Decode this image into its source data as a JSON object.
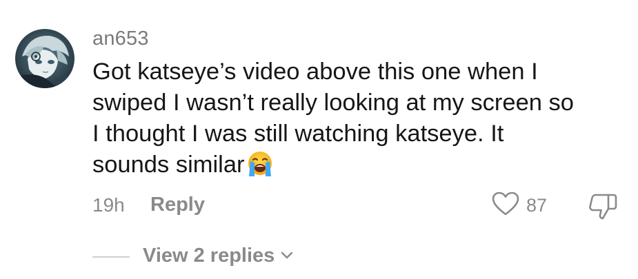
{
  "comment": {
    "username": "an653",
    "text_lines": [
      "Got katseye’s video above this one when I",
      "swiped I wasn’t really looking at my screen so",
      "I thought I was still watching katseye. It",
      "sounds similar"
    ],
    "emoji_icon": "loudly-crying-face-icon",
    "timestamp": "19h",
    "reply_label": "Reply",
    "like_count": "87",
    "view_replies_label": "View 2 replies"
  },
  "colors": {
    "text": "#161616",
    "meta": "#8a8a8a",
    "username": "#7a7a7a",
    "divider": "#cfcfcf",
    "background": "#ffffff"
  }
}
